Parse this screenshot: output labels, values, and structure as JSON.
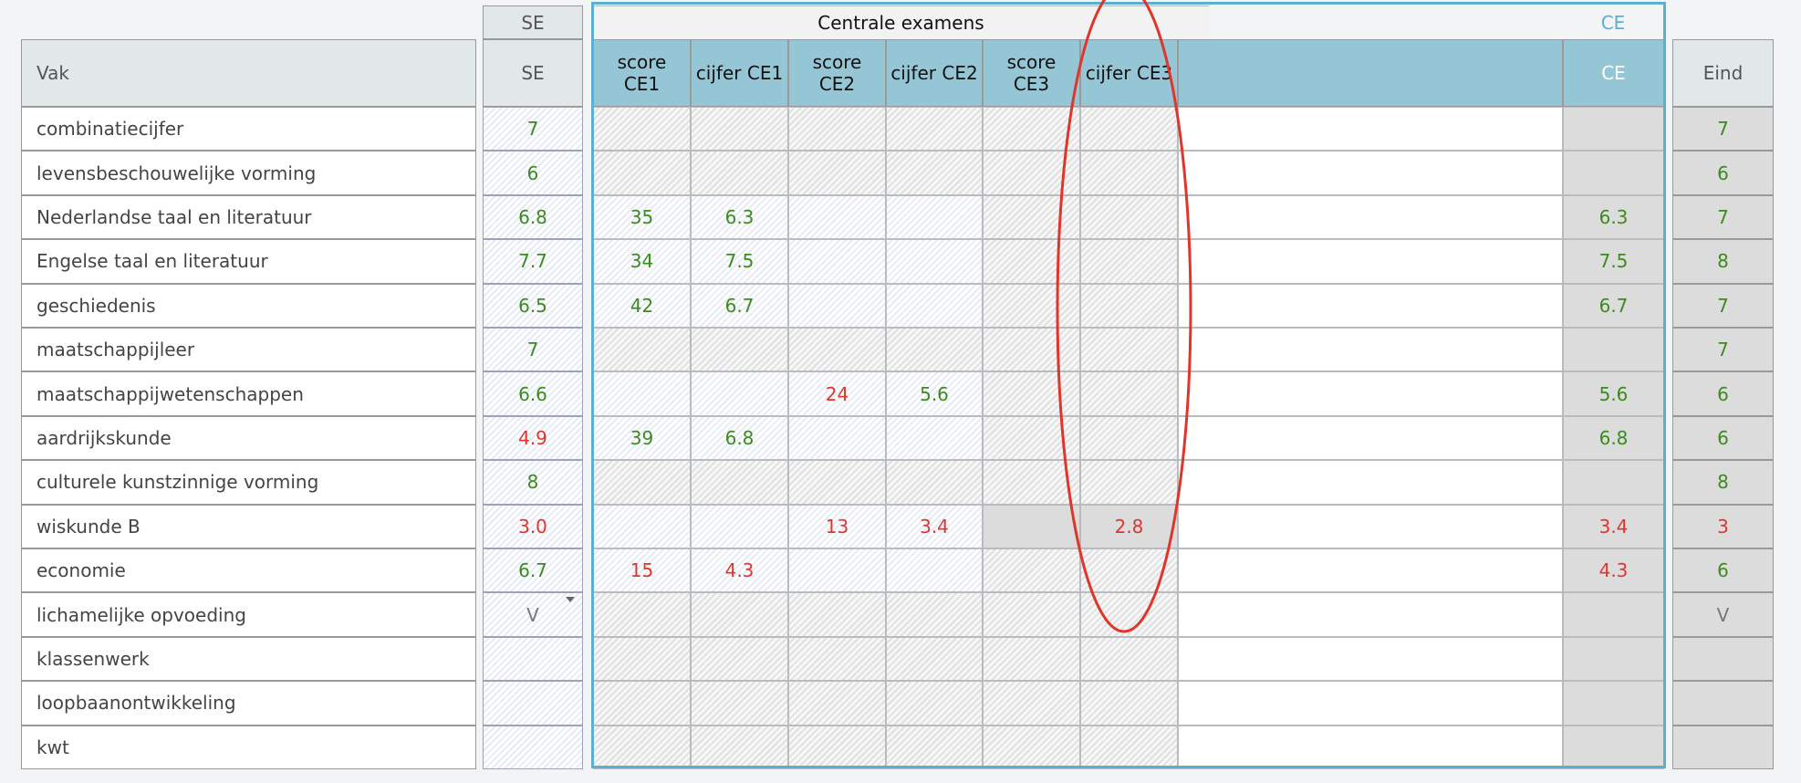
{
  "headers": {
    "se_top": "SE",
    "centrale_examens": "Centrale examens",
    "ce_top": "CE",
    "vak": "Vak",
    "se": "SE",
    "score_ce1": "score CE1",
    "cijfer_ce1": "cijfer CE1",
    "score_ce2": "score CE2",
    "cijfer_ce2": "cijfer CE2",
    "score_ce3": "score CE3",
    "cijfer_ce3": "cijfer CE3",
    "ce": "CE",
    "eind": "Eind"
  },
  "rows": [
    {
      "vak": "combinatiecijfer",
      "se": "7",
      "se_color": "green",
      "score_ce1": "",
      "cijfer_ce1": "",
      "score_ce2": "",
      "cijfer_ce2": "",
      "cijfer_ce3": "",
      "ce": "",
      "eind": "7",
      "eind_color": "green",
      "style": "all_hatch"
    },
    {
      "vak": "levensbeschouwelijke vorming",
      "se": "6",
      "se_color": "green",
      "score_ce1": "",
      "cijfer_ce1": "",
      "score_ce2": "",
      "cijfer_ce2": "",
      "cijfer_ce3": "",
      "ce": "",
      "eind": "6",
      "eind_color": "green",
      "style": "all_hatch"
    },
    {
      "vak": "Nederlandse taal en literatuur",
      "se": "6.8",
      "se_color": "green",
      "score_ce1": "35",
      "score_ce1_color": "green",
      "cijfer_ce1": "6.3",
      "cijfer_ce1_color": "green",
      "score_ce2": "",
      "cijfer_ce2": "",
      "cijfer_ce3": "",
      "ce": "6.3",
      "ce_color": "green",
      "eind": "7",
      "eind_color": "green",
      "style": "exam"
    },
    {
      "vak": "Engelse taal en literatuur",
      "se": "7.7",
      "se_color": "green",
      "score_ce1": "34",
      "score_ce1_color": "green",
      "cijfer_ce1": "7.5",
      "cijfer_ce1_color": "green",
      "score_ce2": "",
      "cijfer_ce2": "",
      "cijfer_ce3": "",
      "ce": "7.5",
      "ce_color": "green",
      "eind": "8",
      "eind_color": "green",
      "style": "exam"
    },
    {
      "vak": "geschiedenis",
      "se": "6.5",
      "se_color": "green",
      "score_ce1": "42",
      "score_ce1_color": "green",
      "cijfer_ce1": "6.7",
      "cijfer_ce1_color": "green",
      "score_ce2": "",
      "cijfer_ce2": "",
      "cijfer_ce3": "",
      "ce": "6.7",
      "ce_color": "green",
      "eind": "7",
      "eind_color": "green",
      "style": "exam"
    },
    {
      "vak": "maatschappijleer",
      "se": "7",
      "se_color": "green",
      "score_ce1": "",
      "cijfer_ce1": "",
      "score_ce2": "",
      "cijfer_ce2": "",
      "cijfer_ce3": "",
      "ce": "",
      "eind": "7",
      "eind_color": "green",
      "style": "all_hatch"
    },
    {
      "vak": "maatschappijwetenschappen",
      "se": "6.6",
      "se_color": "green",
      "score_ce1": "",
      "cijfer_ce1": "",
      "score_ce2": "24",
      "score_ce2_color": "red",
      "cijfer_ce2": "5.6",
      "cijfer_ce2_color": "green",
      "cijfer_ce3": "",
      "ce": "5.6",
      "ce_color": "green",
      "eind": "6",
      "eind_color": "green",
      "style": "exam"
    },
    {
      "vak": "aardrijkskunde",
      "se": "4.9",
      "se_color": "red",
      "score_ce1": "39",
      "score_ce1_color": "green",
      "cijfer_ce1": "6.8",
      "cijfer_ce1_color": "green",
      "score_ce2": "",
      "cijfer_ce2": "",
      "cijfer_ce3": "",
      "ce": "6.8",
      "ce_color": "green",
      "eind": "6",
      "eind_color": "green",
      "style": "exam"
    },
    {
      "vak": "culturele kunstzinnige vorming",
      "se": "8",
      "se_color": "green",
      "score_ce1": "",
      "cijfer_ce1": "",
      "score_ce2": "",
      "cijfer_ce2": "",
      "cijfer_ce3": "",
      "ce": "",
      "eind": "8",
      "eind_color": "green",
      "style": "all_hatch"
    },
    {
      "vak": "wiskunde B",
      "se": "3.0",
      "se_color": "red",
      "score_ce1": "",
      "cijfer_ce1": "",
      "score_ce2": "13",
      "score_ce2_color": "red",
      "cijfer_ce2": "3.4",
      "cijfer_ce2_color": "red",
      "cijfer_ce3": "2.8",
      "cijfer_ce3_color": "red",
      "ce": "3.4",
      "ce_color": "red",
      "eind": "3",
      "eind_color": "red",
      "style": "exam_ce3"
    },
    {
      "vak": "economie",
      "se": "6.7",
      "se_color": "green",
      "score_ce1": "15",
      "score_ce1_color": "red",
      "cijfer_ce1": "4.3",
      "cijfer_ce1_color": "red",
      "score_ce2": "",
      "cijfer_ce2": "",
      "cijfer_ce3": "",
      "ce": "4.3",
      "ce_color": "red",
      "eind": "6",
      "eind_color": "green",
      "style": "exam"
    },
    {
      "vak": "lichamelijke opvoeding",
      "se": "V",
      "se_color": "grey",
      "se_dropdown": true,
      "score_ce1": "",
      "cijfer_ce1": "",
      "score_ce2": "",
      "cijfer_ce2": "",
      "cijfer_ce3": "",
      "ce": "",
      "eind": "V",
      "eind_color": "grey",
      "style": "all_hatch"
    },
    {
      "vak": "klassenwerk",
      "se": "",
      "se_color": "green",
      "score_ce1": "",
      "cijfer_ce1": "",
      "score_ce2": "",
      "cijfer_ce2": "",
      "cijfer_ce3": "",
      "ce": "",
      "eind": "",
      "eind_color": "green",
      "style": "all_hatch"
    },
    {
      "vak": "loopbaanontwikkeling",
      "se": "",
      "se_color": "green",
      "score_ce1": "",
      "cijfer_ce1": "",
      "score_ce2": "",
      "cijfer_ce2": "",
      "cijfer_ce3": "",
      "ce": "",
      "eind": "",
      "eind_color": "green",
      "style": "all_hatch"
    },
    {
      "vak": "kwt",
      "se": "",
      "se_color": "green",
      "score_ce1": "",
      "cijfer_ce1": "",
      "score_ce2": "",
      "cijfer_ce2": "",
      "cijfer_ce3": "",
      "ce": "",
      "eind": "",
      "eind_color": "green",
      "style": "all_hatch"
    }
  ],
  "colors": {
    "green": "#3b8b1e",
    "red": "#e0352b",
    "highlight_blue": "#5aafd2",
    "annotation_red": "#e0352b",
    "header_blue": "#95c6d6"
  }
}
